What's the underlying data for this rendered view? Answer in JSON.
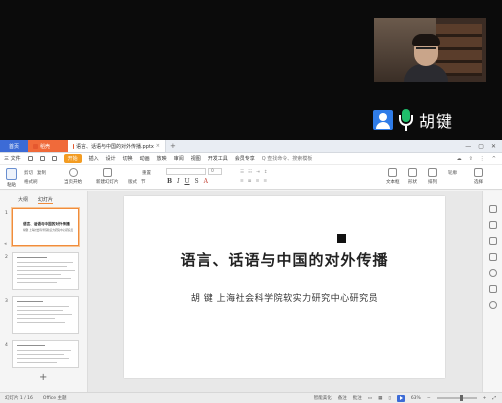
{
  "meeting": {
    "speaker_name": "胡键"
  },
  "window": {
    "tabs": [
      {
        "label": "首页"
      },
      {
        "label": "稻壳"
      },
      {
        "label": "语言、话语与中国的对外传播.pptx"
      }
    ],
    "tab_plus": "+"
  },
  "menu": {
    "file": "三 文件",
    "items": [
      "开始",
      "插入",
      "设计",
      "切换",
      "动画",
      "放映",
      "审阅",
      "视图",
      "开发工具",
      "会员专享"
    ],
    "search": "Q 查找命令、搜索模板"
  },
  "ribbon": {
    "paste": "粘贴",
    "cut": "剪切",
    "copy": "复制",
    "format_painter": "格式刷",
    "from_current": "当页开始",
    "new_slide": "新建幻灯片",
    "layout": "版式",
    "section": "节",
    "reset": "重置",
    "font_size_placeholder": "0",
    "text_box": "文本框",
    "shape": "形状",
    "arrange": "排列",
    "outline": "轮廓",
    "select": "选择"
  },
  "thumbnails": {
    "tab_outline": "大纲",
    "tab_slides": "幻灯片",
    "slides": [
      {
        "num": "1",
        "title": "语言、话语与中国的对外传播",
        "sub": "胡键 上海社会科学院软实力研究中心研究员"
      },
      {
        "num": "2"
      },
      {
        "num": "3"
      },
      {
        "num": "4"
      }
    ],
    "add": "+"
  },
  "slide": {
    "title": "语言、话语与中国的对外传播",
    "author_line": "胡  键   上海社会科学院软实力研究中心研究员"
  },
  "notes": {
    "placeholder": "单击此处添加备注"
  },
  "status": {
    "slide_counter": "幻灯片 1 / 16",
    "theme": "Office 主题",
    "smart_beautify": "智能美化",
    "notes": "备注",
    "comments": "批注",
    "zoom": "63%"
  },
  "zoom_level": 0.63
}
